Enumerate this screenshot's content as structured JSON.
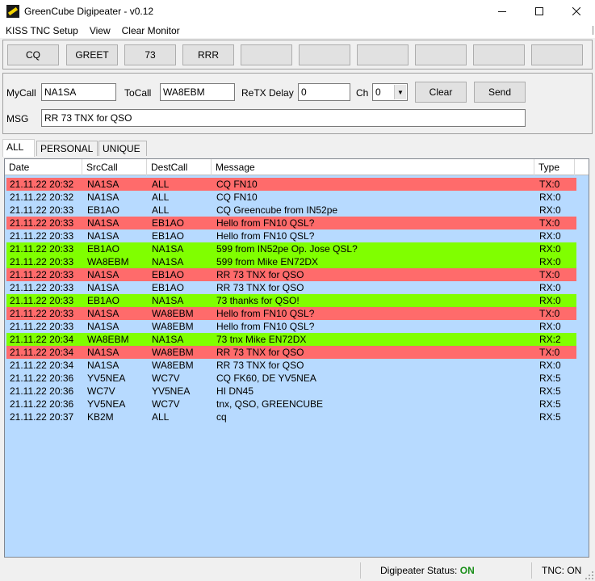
{
  "window": {
    "title": "GreenCube Digipeater - v0.12"
  },
  "menu": [
    {
      "label": "KISS TNC Setup"
    },
    {
      "label": "View"
    },
    {
      "label": "Clear Monitor"
    }
  ],
  "quick_buttons": [
    "CQ",
    "GREET",
    "73",
    "RRR",
    "",
    "",
    "",
    "",
    "",
    ""
  ],
  "form": {
    "mycall_label": "MyCall",
    "mycall_value": "NA1SA",
    "tocall_label": "ToCall",
    "tocall_value": "WA8EBM",
    "retx_label": "ReTX Delay",
    "retx_value": "0",
    "ch_label": "Ch",
    "ch_value": "0",
    "clear_label": "Clear",
    "send_label": "Send",
    "msg_label": "MSG",
    "msg_value": "RR 73  TNX for QSO"
  },
  "tabs": [
    {
      "label": "ALL"
    },
    {
      "label": "PERSONAL"
    },
    {
      "label": "UNIQUE"
    }
  ],
  "columns": [
    "Date",
    "SrcCall",
    "DestCall",
    "Message",
    "Type"
  ],
  "colors": {
    "tx": "#ff6b6b",
    "rx_green": "#80ff00",
    "rx": "#b7daff"
  },
  "rows": [
    {
      "date": "21.11.22 20:32",
      "src": "NA1SA",
      "dest": "ALL",
      "msg": "CQ  FN10",
      "type": "TX:0",
      "color": "tx"
    },
    {
      "date": "21.11.22 20:32",
      "src": "NA1SA",
      "dest": "ALL",
      "msg": "CQ  FN10",
      "type": "RX:0",
      "color": "rx"
    },
    {
      "date": "21.11.22 20:33",
      "src": "EB1AO",
      "dest": "ALL",
      "msg": "CQ Greencube from IN52pe",
      "type": "RX:0",
      "color": "rx"
    },
    {
      "date": "21.11.22 20:33",
      "src": "NA1SA",
      "dest": "EB1AO",
      "msg": "Hello from FN10  QSL?",
      "type": "TX:0",
      "color": "tx"
    },
    {
      "date": "21.11.22 20:33",
      "src": "NA1SA",
      "dest": "EB1AO",
      "msg": "Hello from FN10  QSL?",
      "type": "RX:0",
      "color": "rx"
    },
    {
      "date": "21.11.22 20:33",
      "src": "EB1AO",
      "dest": "NA1SA",
      "msg": "599 from IN52pe  Op. Jose QSL?",
      "type": "RX:0",
      "color": "rx_green"
    },
    {
      "date": "21.11.22 20:33",
      "src": "WA8EBM",
      "dest": "NA1SA",
      "msg": "599 from Mike EN72DX",
      "type": "RX:0",
      "color": "rx_green"
    },
    {
      "date": "21.11.22 20:33",
      "src": "NA1SA",
      "dest": "EB1AO",
      "msg": "RR 73  TNX for QSO",
      "type": "TX:0",
      "color": "tx"
    },
    {
      "date": "21.11.22 20:33",
      "src": "NA1SA",
      "dest": "EB1AO",
      "msg": "RR 73  TNX for QSO",
      "type": "RX:0",
      "color": "rx"
    },
    {
      "date": "21.11.22 20:33",
      "src": "EB1AO",
      "dest": "NA1SA",
      "msg": "73 thanks for QSO!",
      "type": "RX:0",
      "color": "rx_green"
    },
    {
      "date": "21.11.22 20:33",
      "src": "NA1SA",
      "dest": "WA8EBM",
      "msg": "Hello from FN10  QSL?",
      "type": "TX:0",
      "color": "tx"
    },
    {
      "date": "21.11.22 20:33",
      "src": "NA1SA",
      "dest": "WA8EBM",
      "msg": "Hello from FN10  QSL?",
      "type": "RX:0",
      "color": "rx"
    },
    {
      "date": "21.11.22 20:34",
      "src": "WA8EBM",
      "dest": "NA1SA",
      "msg": "73  tnx Mike EN72DX",
      "type": "RX:2",
      "color": "rx_green"
    },
    {
      "date": "21.11.22 20:34",
      "src": "NA1SA",
      "dest": "WA8EBM",
      "msg": "RR 73  TNX for QSO",
      "type": "TX:0",
      "color": "tx"
    },
    {
      "date": "21.11.22 20:34",
      "src": "NA1SA",
      "dest": "WA8EBM",
      "msg": "RR 73  TNX for QSO",
      "type": "RX:0",
      "color": "rx"
    },
    {
      "date": "21.11.22 20:36",
      "src": "YV5NEA",
      "dest": "WC7V",
      "msg": "CQ FK60, DE YV5NEA",
      "type": "RX:5",
      "color": "rx"
    },
    {
      "date": "21.11.22 20:36",
      "src": "WC7V",
      "dest": "YV5NEA",
      "msg": "HI DN45",
      "type": "RX:5",
      "color": "rx"
    },
    {
      "date": "21.11.22 20:36",
      "src": "YV5NEA",
      "dest": "WC7V",
      "msg": "tnx, QSO, GREENCUBE",
      "type": "RX:5",
      "color": "rx"
    },
    {
      "date": "21.11.22 20:37",
      "src": "KB2M",
      "dest": "ALL",
      "msg": "cq",
      "type": "RX:5",
      "color": "rx"
    }
  ],
  "status": {
    "digi_label": "Digipeater Status:",
    "digi_value": "ON",
    "tnc": "TNC: ON"
  }
}
